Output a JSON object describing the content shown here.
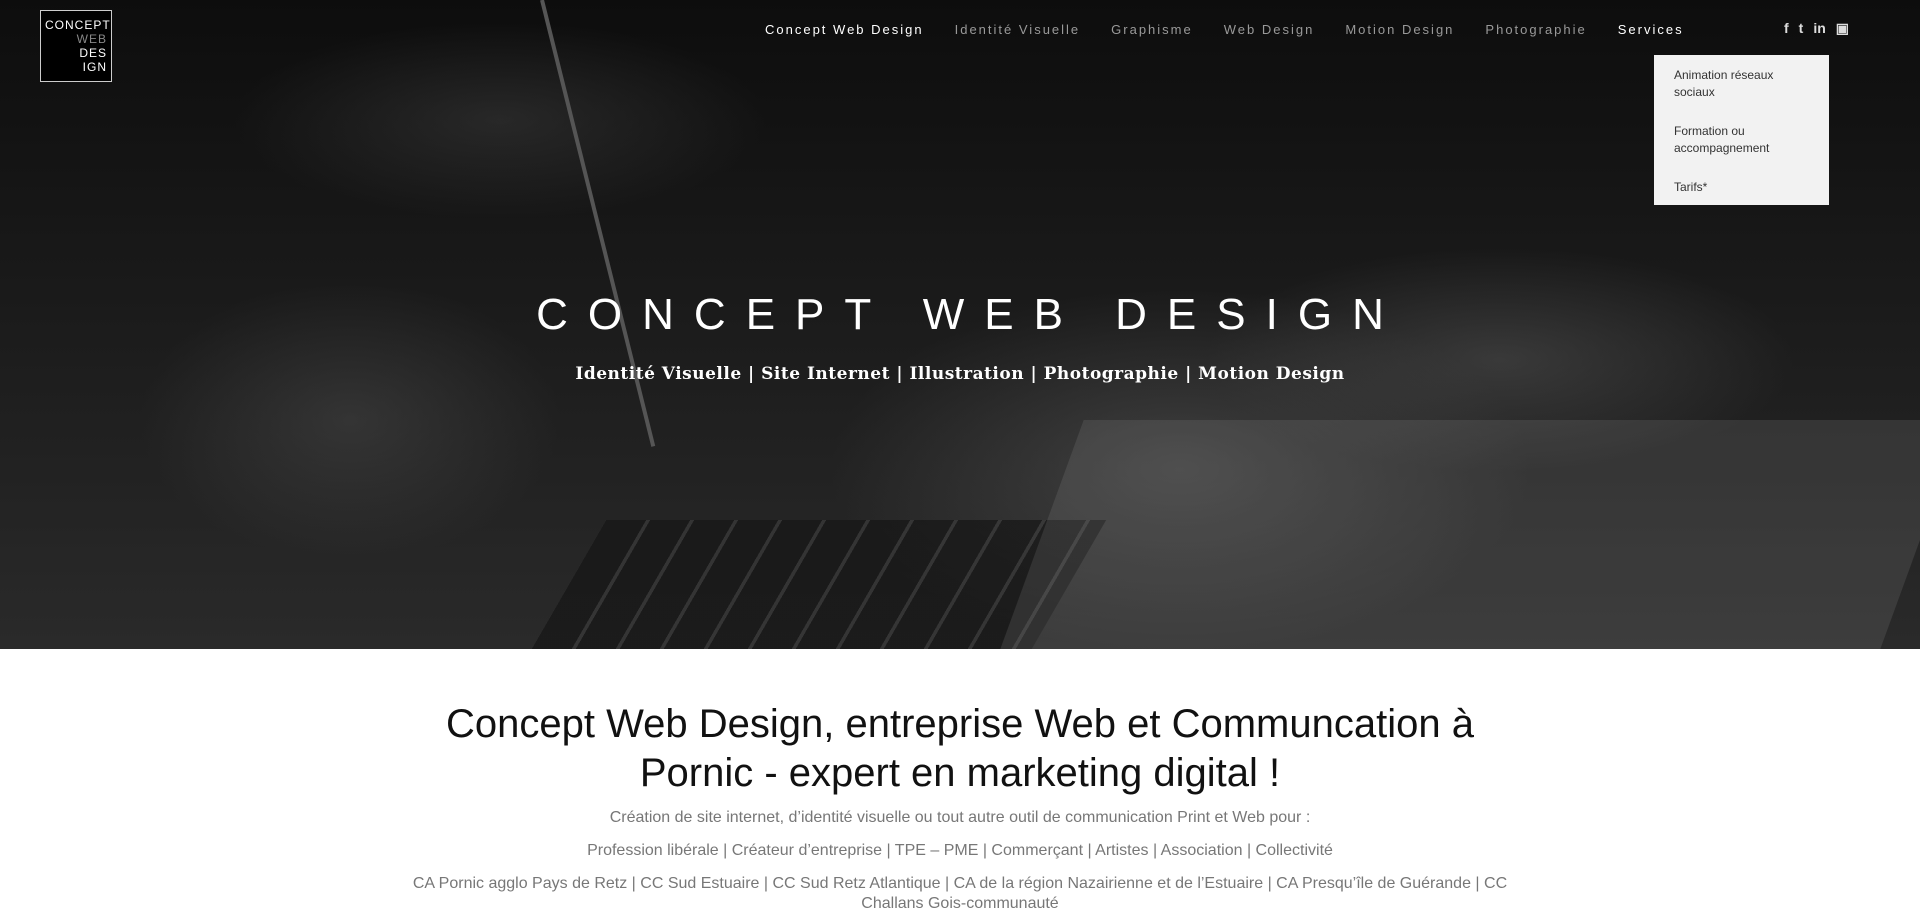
{
  "logo": {
    "line1": "CONCEPT",
    "line2": "WEB",
    "line3": "DES",
    "line4": "IGN"
  },
  "nav": {
    "items": [
      "Concept Web Design",
      "Identité Visuelle",
      "Graphisme",
      "Web Design",
      "Motion Design",
      "Photographie",
      "Services"
    ],
    "active": "Concept Web Design"
  },
  "social": {
    "facebook": "f",
    "twitter": "t",
    "linkedin": "in",
    "youtube": "▣"
  },
  "dropdown": {
    "items": [
      "Animation réseaux sociaux",
      "Formation ou accompagnement",
      "Tarifs*"
    ]
  },
  "hero": {
    "title": "CONCEPT WEB DESIGN",
    "subtitle": "Identité Visuelle | Site Internet | Illustration | Photographie | Motion Design"
  },
  "main": {
    "heading": "Concept Web Design, entreprise Web et Communcation à Pornic - expert en marketing digital !",
    "intro": "Création de site internet, d’identité visuelle ou tout autre outil de communication Print et Web pour :",
    "audiences": "Profession libérale | Créateur d’entreprise | TPE – PME | Commerçant | Artistes | Association | Collectivité",
    "areas": "CA Pornic agglo Pays de Retz | CC Sud Estuaire | CC Sud Retz Atlantique | CA de la région Nazairienne et de l’Estuaire | CA Presqu’île de Guérande | CC Challans Gois-communauté"
  }
}
